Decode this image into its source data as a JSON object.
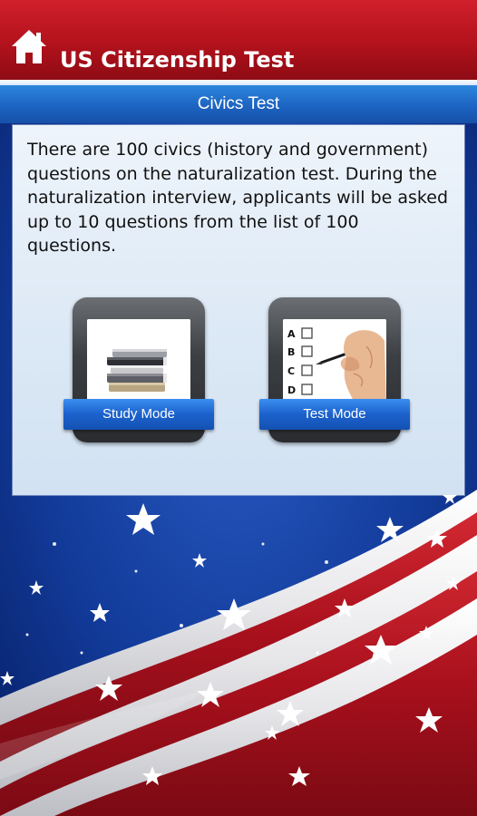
{
  "header": {
    "title": "US Citizenship Test",
    "home_icon": "home-icon"
  },
  "subheader": {
    "title": "Civics Test"
  },
  "content": {
    "description": "There are 100 civics (history and government) questions on the naturalization test. During the naturalization interview, applicants will be asked up to 10 questions from the list of 100 questions."
  },
  "modes": [
    {
      "label": "Study Mode",
      "icon": "books-icon"
    },
    {
      "label": "Test Mode",
      "icon": "checklist-icon"
    }
  ],
  "checklist_letters": [
    "A",
    "B",
    "C",
    "D"
  ],
  "colors": {
    "header_red": "#b3121c",
    "subheader_blue": "#1d64c2",
    "ribbon_blue": "#1b61cc",
    "background_navy": "#0b2d86"
  }
}
